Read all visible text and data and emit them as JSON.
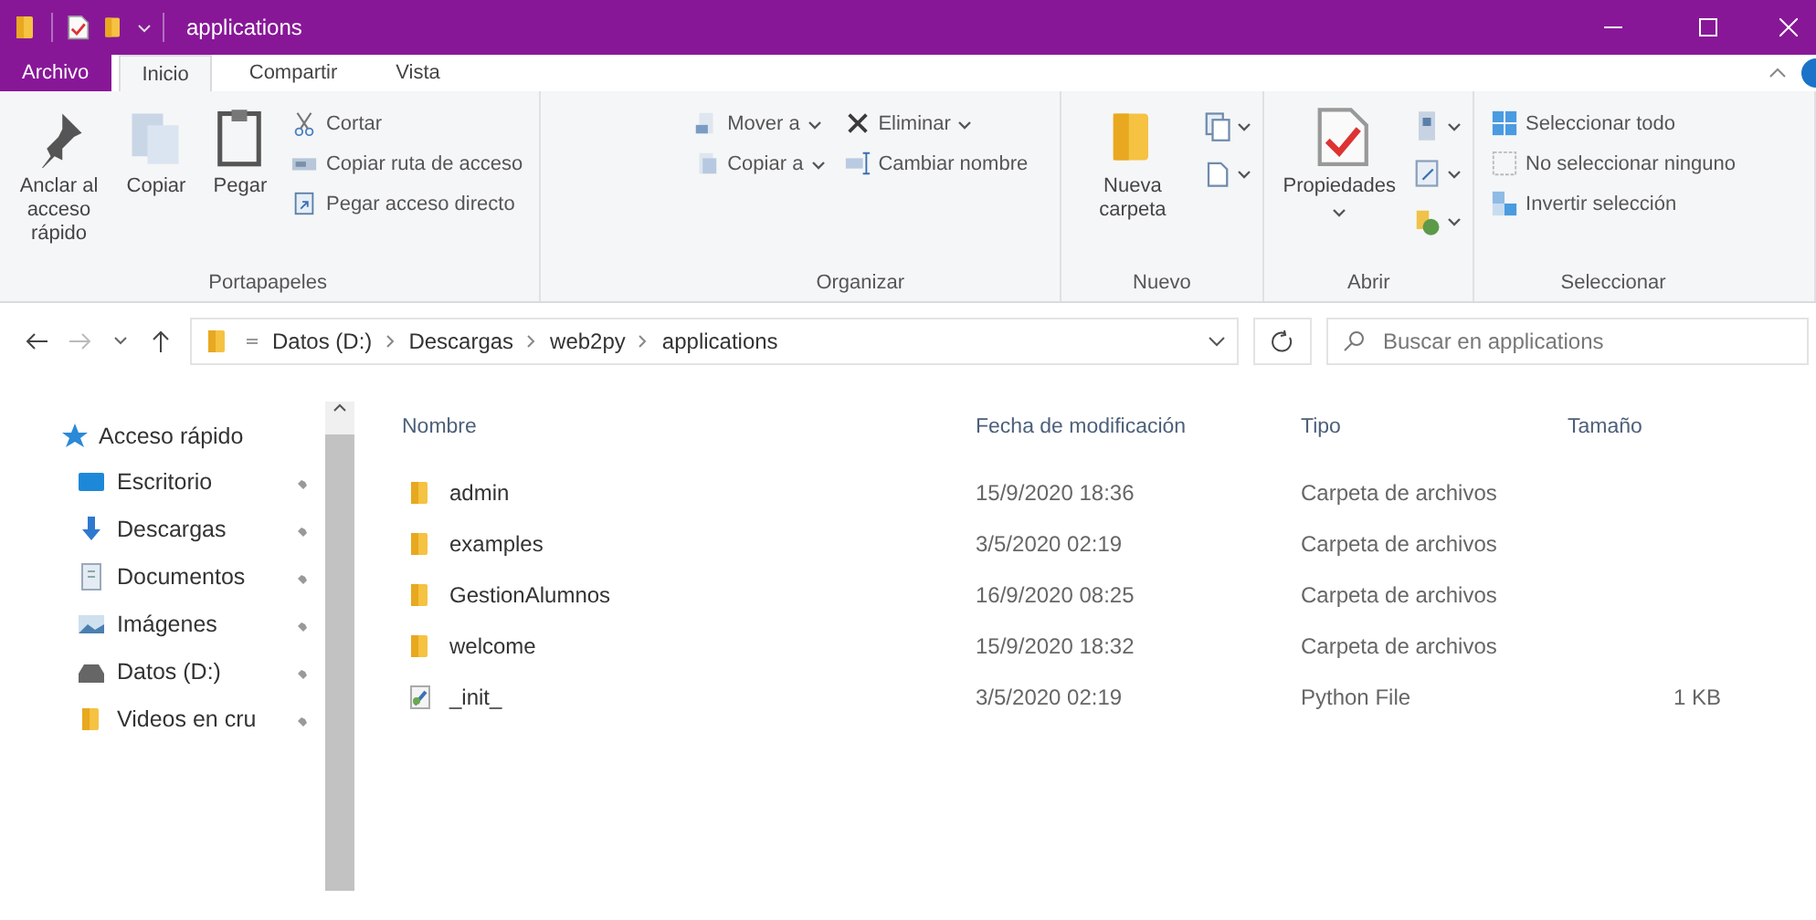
{
  "window": {
    "title": "applications"
  },
  "ribbon_tabs": [
    {
      "label": "Archivo",
      "kind": "file",
      "selected": false
    },
    {
      "label": "Inicio",
      "kind": "tab",
      "selected": true
    },
    {
      "label": "Compartir",
      "kind": "tab",
      "selected": false
    },
    {
      "label": "Vista",
      "kind": "tab",
      "selected": false
    }
  ],
  "ribbon_groups": [
    {
      "label": "Portapapeles",
      "items": [
        {
          "kind": "large",
          "label": "Anclar al acceso rápido"
        },
        {
          "kind": "large",
          "label": "Copiar"
        },
        {
          "kind": "large",
          "label": "Pegar"
        },
        {
          "kind": "stack",
          "items": [
            {
              "label": "Cortar"
            },
            {
              "label": "Copiar ruta de acceso"
            },
            {
              "label": "Pegar acceso directo"
            }
          ]
        }
      ]
    },
    {
      "label": "Organizar",
      "items": [
        {
          "kind": "stack",
          "items": [
            {
              "label": "Mover a"
            },
            {
              "label": "Copiar a"
            }
          ]
        },
        {
          "kind": "stack",
          "items": [
            {
              "label": "Eliminar"
            },
            {
              "label": "Cambiar nombre"
            }
          ]
        }
      ]
    },
    {
      "label": "Nuevo",
      "items": [
        {
          "kind": "large",
          "label": "Nueva carpeta"
        }
      ]
    },
    {
      "label": "Abrir",
      "items": [
        {
          "kind": "large",
          "label": "Propiedades"
        }
      ]
    },
    {
      "label": "Seleccionar",
      "items": [
        {
          "kind": "stack",
          "items": [
            {
              "label": "Seleccionar todo"
            },
            {
              "label": "No seleccionar ninguno"
            },
            {
              "label": "Invertir selección"
            }
          ]
        }
      ]
    }
  ],
  "address_bar": {
    "path": [
      "Datos (D:)",
      "Descargas",
      "web2py",
      "applications"
    ]
  },
  "search": {
    "placeholder": "Buscar en applications"
  },
  "sidebar": {
    "header": "Acceso rápido",
    "items": [
      {
        "label": "Escritorio",
        "pinned": true
      },
      {
        "label": "Descargas",
        "pinned": true
      },
      {
        "label": "Documentos",
        "pinned": true
      },
      {
        "label": "Imágenes",
        "pinned": true
      },
      {
        "label": "Datos (D:)",
        "pinned": true
      },
      {
        "label": "Videos en cru",
        "pinned": true
      }
    ]
  },
  "table": {
    "columns": [
      "Nombre",
      "Fecha de modificación",
      "Tipo",
      "Tamaño"
    ],
    "rows": [
      {
        "kind": "folder",
        "name": "admin",
        "date": "15/9/2020 18:36",
        "type": "Carpeta de archivos"
      },
      {
        "kind": "folder",
        "name": "examples",
        "date": "3/5/2020 02:19",
        "type": "Carpeta de archivos"
      },
      {
        "kind": "folder",
        "name": "GestionAlumnos",
        "date": "16/9/2020 08:25",
        "type": "Carpeta de archivos"
      },
      {
        "kind": "folder",
        "name": "welcome",
        "date": "15/9/2020 18:32",
        "type": "Carpeta de archivos"
      },
      {
        "kind": "file",
        "name": "_init_",
        "date": "3/5/2020 02:19",
        "type": "Python File",
        "size": "1 KB"
      }
    ]
  }
}
